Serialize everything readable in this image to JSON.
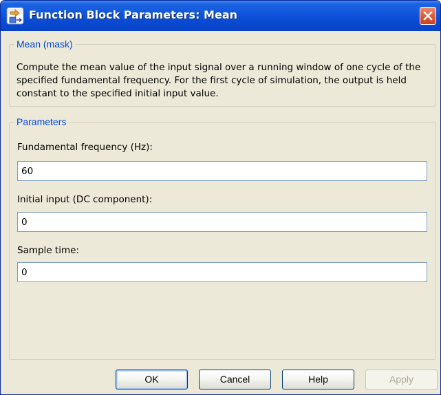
{
  "window": {
    "title": "Function Block Parameters: Mean",
    "icon": "simulink-block-icon",
    "close_icon": "close-icon"
  },
  "mask_group": {
    "legend": "Mean (mask)",
    "description": "Compute the mean value of the input signal over a running window of one cycle of the specified fundamental frequency. For the first cycle of simulation, the output is held constant to the specified initial input value."
  },
  "parameters_group": {
    "legend": "Parameters",
    "fields": [
      {
        "label": "Fundamental frequency (Hz):",
        "value": "60"
      },
      {
        "label": "Initial input (DC component):",
        "value": "0"
      },
      {
        "label": "Sample time:",
        "value": "0"
      }
    ]
  },
  "buttons": {
    "ok": "OK",
    "cancel": "Cancel",
    "help": "Help",
    "apply": "Apply"
  },
  "colors": {
    "titlebar": "#0a4ad2",
    "dialog_background": "#ece9d8",
    "group_legend": "#0046d5",
    "close_button": "#de5c3a"
  }
}
